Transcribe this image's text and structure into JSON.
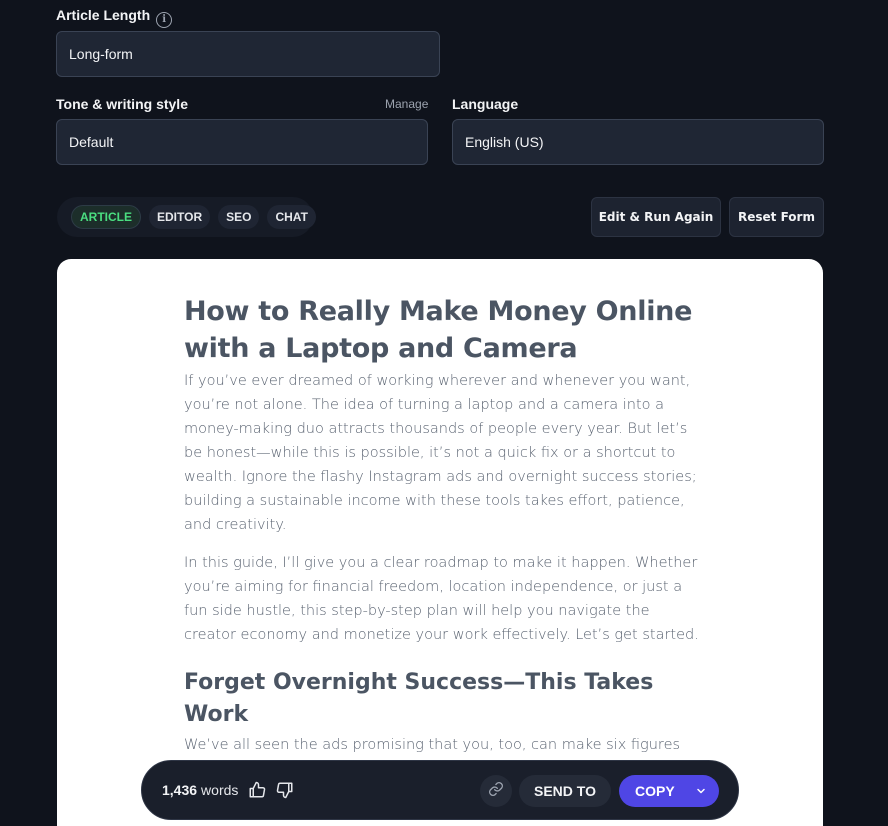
{
  "form": {
    "article_length": {
      "label": "Article Length",
      "value": "Long-form"
    },
    "tone": {
      "label": "Tone & writing style",
      "manage_label": "Manage",
      "value": "Default"
    },
    "language": {
      "label": "Language",
      "value": "English (US)"
    }
  },
  "tabs": [
    {
      "label": "ARTICLE",
      "active": true
    },
    {
      "label": "EDITOR",
      "active": false
    },
    {
      "label": "SEO",
      "active": false
    },
    {
      "label": "CHAT",
      "active": false
    }
  ],
  "actions": {
    "edit_run_label": "Edit & Run Again",
    "reset_label": "Reset Form"
  },
  "article": {
    "title": "How to Really Make Money Online with a Laptop and Camera",
    "paragraphs": [
      "If you’ve ever dreamed of working wherever and whenever you want, you’re not alone. The idea of turning a laptop and a camera into a money-making duo attracts thousands of people every year. But let’s be honest—while this is possible, it’s not a quick fix or a shortcut to wealth. Ignore the flashy Instagram ads and overnight success stories; building a sustainable income with these tools takes effort, patience, and creativity.",
      "In this guide, I’ll give you a clear roadmap to make it happen. Whether you’re aiming for financial freedom, location independence, or just a fun side hustle, this step-by-step plan will help you navigate the creator economy and monetize your work effectively. Let’s get started."
    ],
    "section_heading": "Forget Overnight Success—This Takes Work",
    "section_paragraph": "We’ve all seen the ads promising that you, too, can make six figures simply by signing up for some mastermind course. Spoiler alert: they’re"
  },
  "bottom_bar": {
    "word_count": "1,436",
    "word_label": "words",
    "send_to_label": "SEND TO",
    "copy_label": "COPY"
  },
  "colors": {
    "accent": "#4f46e5",
    "active_tab": "#4ade80",
    "background": "#0f131c"
  }
}
